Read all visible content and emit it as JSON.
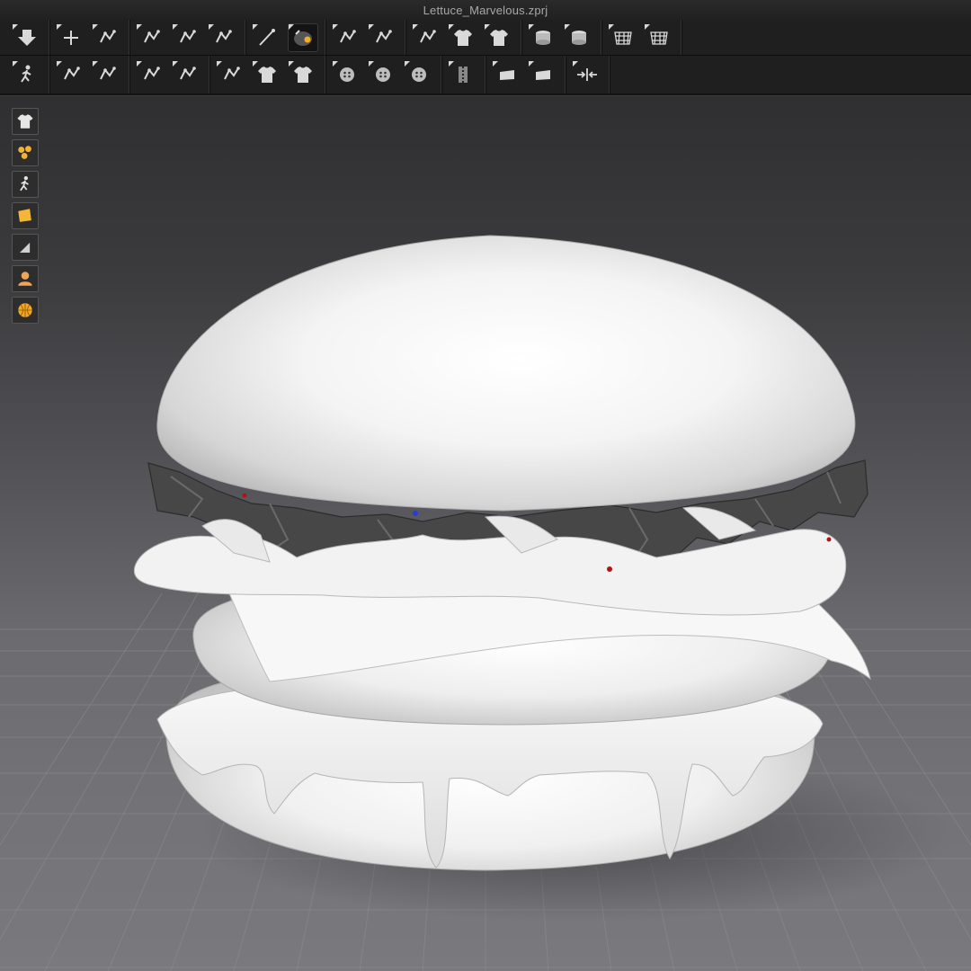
{
  "window": {
    "title": "Lettuce_Marvelous.zprj"
  },
  "toolbar_row1": [
    {
      "group": "file",
      "items": [
        {
          "icon": "download-arrow-icon"
        }
      ]
    },
    {
      "group": "transform",
      "items": [
        {
          "icon": "move-cross-icon"
        },
        {
          "icon": "edit-pattern-icon"
        }
      ]
    },
    {
      "group": "segment",
      "items": [
        {
          "icon": "transform-pattern-icon"
        },
        {
          "icon": "edit-point-icon"
        },
        {
          "icon": "edit-curvature-icon"
        }
      ]
    },
    {
      "group": "draw",
      "items": [
        {
          "icon": "pen-line-icon"
        },
        {
          "icon": "simulation-orb-icon",
          "active": true
        }
      ]
    },
    {
      "group": "sew",
      "items": [
        {
          "icon": "segment-sewing-icon"
        },
        {
          "icon": "free-sewing-icon"
        }
      ]
    },
    {
      "group": "garment",
      "items": [
        {
          "icon": "fold-arrangement-icon"
        },
        {
          "icon": "shirt-icon"
        },
        {
          "icon": "box-garment-icon"
        }
      ]
    },
    {
      "group": "layers",
      "items": [
        {
          "icon": "layer-stack-icon"
        },
        {
          "icon": "cylinder-stack-icon"
        }
      ]
    },
    {
      "group": "grid",
      "items": [
        {
          "icon": "mesh-grid-icon"
        },
        {
          "icon": "mesh-grid-perspective-icon"
        }
      ]
    }
  ],
  "toolbar_row2": [
    {
      "group": "avatar",
      "items": [
        {
          "icon": "walking-avatar-icon"
        }
      ]
    },
    {
      "group": "pins",
      "items": [
        {
          "icon": "pin-cloth-icon"
        },
        {
          "icon": "pin-cloth-alt-icon"
        }
      ]
    },
    {
      "group": "fold",
      "items": [
        {
          "icon": "fold-line-icon"
        },
        {
          "icon": "fold-angle-icon"
        }
      ]
    },
    {
      "group": "texture",
      "items": [
        {
          "icon": "texture-edit-icon"
        },
        {
          "icon": "texture-shirt-icon"
        },
        {
          "icon": "texture-shirt-alt-icon"
        }
      ]
    },
    {
      "group": "buttons",
      "items": [
        {
          "icon": "button-place-icon"
        },
        {
          "icon": "button-icon"
        },
        {
          "icon": "buttonhole-icon"
        }
      ]
    },
    {
      "group": "zipper",
      "items": [
        {
          "icon": "zipper-icon"
        }
      ]
    },
    {
      "group": "tape",
      "items": [
        {
          "icon": "tape-icon"
        },
        {
          "icon": "tape-alt-icon"
        }
      ]
    },
    {
      "group": "measure",
      "items": [
        {
          "icon": "measure-arrows-icon"
        }
      ]
    }
  ],
  "sidebar": [
    {
      "icon": "garment-shirt-icon",
      "color": "#e6e6e6"
    },
    {
      "icon": "fabric-swatch-icon",
      "color": "#f2b233"
    },
    {
      "icon": "avatar-person-icon",
      "color": "#e6e6e6"
    },
    {
      "icon": "texture-orange-icon",
      "color": "#f5b638"
    },
    {
      "icon": "silhouette-icon",
      "color": "#cfcfcf"
    },
    {
      "icon": "skin-person-icon",
      "color": "#f0a45a"
    },
    {
      "icon": "globe-icon",
      "color": "#f2a825"
    }
  ],
  "viewport": {
    "floor_grid": true,
    "object": "burger-mesh"
  }
}
